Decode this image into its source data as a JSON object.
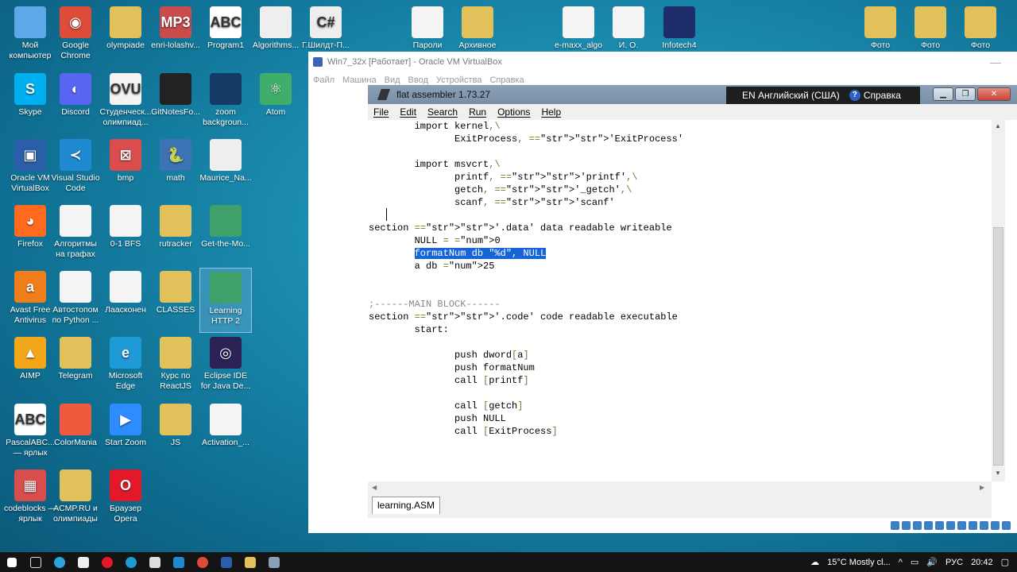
{
  "desktop_icons": [
    {
      "label": "Мой компьютер",
      "color": "#5fa8e8",
      "glyph": ""
    },
    {
      "label": "Google Chrome",
      "color": "#dd4b39",
      "glyph": "◉"
    },
    {
      "label": "olympiade",
      "color": "#e2c15a",
      "glyph": ""
    },
    {
      "label": "enri-lolashv...",
      "color": "#c94b4b",
      "glyph": "MP3"
    },
    {
      "label": "Program1",
      "color": "#ffffff",
      "glyph": "ABC"
    },
    {
      "label": "Algorithms...",
      "color": "#eeeeee",
      "glyph": ""
    },
    {
      "label": "Г.Шилдт-П...",
      "color": "#eeeeee",
      "glyph": "C#"
    },
    {
      "label": "Пароли",
      "color": "#f4f4f4",
      "glyph": ""
    },
    {
      "label": "Архивное",
      "color": "#e2c15a",
      "glyph": ""
    },
    {
      "label": "e-maxx_algo",
      "color": "#f4f4f4",
      "glyph": ""
    },
    {
      "label": "И. О.",
      "color": "#f4f4f4",
      "glyph": ""
    },
    {
      "label": "Infotech4",
      "color": "#1d2e6b",
      "glyph": ""
    },
    {
      "label": "Фото",
      "color": "#e2c15a",
      "glyph": ""
    },
    {
      "label": "Фото",
      "color": "#e2c15a",
      "glyph": ""
    },
    {
      "label": "Фото",
      "color": "#e2c15a",
      "glyph": ""
    },
    {
      "label": "Skype",
      "color": "#00aff0",
      "glyph": "S"
    },
    {
      "label": "Discord",
      "color": "#5865f2",
      "glyph": "◐"
    },
    {
      "label": "Студенческ... олимпиад...",
      "color": "#f4f4f4",
      "glyph": "OVU"
    },
    {
      "label": "GitNotesFo...",
      "color": "#222222",
      "glyph": ""
    },
    {
      "label": "zoom backgroun...",
      "color": "#143a66",
      "glyph": ""
    },
    {
      "label": "Atom",
      "color": "#3fae6a",
      "glyph": "⚛"
    },
    {
      "label": "Oracle VM VirtualBox",
      "color": "#2a5ea8",
      "glyph": "▣"
    },
    {
      "label": "Visual Studio Code",
      "color": "#1f8ad2",
      "glyph": "≺"
    },
    {
      "label": "bmp",
      "color": "#d94d4d",
      "glyph": "⊠"
    },
    {
      "label": "math",
      "color": "#3b73b5",
      "glyph": "🐍"
    },
    {
      "label": "Maurice_Na...",
      "color": "#eeeeee",
      "glyph": ""
    },
    {
      "label": "Firefox",
      "color": "#ff6a1e",
      "glyph": "◕"
    },
    {
      "label": "Алгоритмы на графах",
      "color": "#f4f4f4",
      "glyph": ""
    },
    {
      "label": "0-1 BFS",
      "color": "#f4f4f4",
      "glyph": ""
    },
    {
      "label": "rutracker",
      "color": "#e2c15a",
      "glyph": ""
    },
    {
      "label": "Get-the-Mo...",
      "color": "#3fa06a",
      "glyph": ""
    },
    {
      "label": "Avast Free Antivirus",
      "color": "#f07e1a",
      "glyph": "a"
    },
    {
      "label": "Автостопом по Python ...",
      "color": "#f4f4f4",
      "glyph": ""
    },
    {
      "label": "Лаасконен",
      "color": "#f4f4f4",
      "glyph": ""
    },
    {
      "label": "CLASSES",
      "color": "#e2c15a",
      "glyph": ""
    },
    {
      "label": "Learning HTTP 2",
      "color": "#3fa06a",
      "glyph": ""
    },
    {
      "label": "AIMP",
      "color": "#f2a71b",
      "glyph": "▲"
    },
    {
      "label": "Telegram",
      "color": "#e2c15a",
      "glyph": ""
    },
    {
      "label": "Microsoft Edge",
      "color": "#1e9ad6",
      "glyph": "e"
    },
    {
      "label": "Курс по ReactJS",
      "color": "#e2c15a",
      "glyph": ""
    },
    {
      "label": "Eclipse IDE for Java De...",
      "color": "#2c2255",
      "glyph": "◎"
    },
    {
      "label": "PascalABC... — ярлык",
      "color": "#ffffff",
      "glyph": "ABC"
    },
    {
      "label": "ColorMania",
      "color": "#ef5a3c",
      "glyph": ""
    },
    {
      "label": "Start Zoom",
      "color": "#2d8cff",
      "glyph": "▶"
    },
    {
      "label": "JS",
      "color": "#e2c15a",
      "glyph": ""
    },
    {
      "label": "Activation_...",
      "color": "#f4f4f4",
      "glyph": ""
    },
    {
      "label": "codeblocks — ярлык",
      "color": "#d94d4d",
      "glyph": "▦"
    },
    {
      "label": "ACMP.RU и олимпиады",
      "color": "#e2c15a",
      "glyph": ""
    },
    {
      "label": "Браузер Opera",
      "color": "#e3192a",
      "glyph": "O"
    }
  ],
  "vm_window": {
    "title": "Win7_32x [Работает] - Oracle VM VirtualBox",
    "menu": [
      "Файл",
      "Машина",
      "Вид",
      "Ввод",
      "Устройства",
      "Справка"
    ]
  },
  "fasm": {
    "title": "flat assembler 1.73.27",
    "lang": "EN Английский (США)",
    "help": "Справка",
    "menu": [
      "File",
      "Edit",
      "Search",
      "Run",
      "Options",
      "Help"
    ],
    "tab": "learning.ASM",
    "code_lines": [
      "        import kernel,\\",
      "               ExitProcess, 'ExitProcess'",
      "",
      "        import msvcrt,\\",
      "               printf, 'printf',\\",
      "               getch, '_getch',\\",
      "               scanf, 'scanf'",
      "",
      "section '.data' data readable writeable",
      "        NULL = 0",
      "        formatNum db \"%d\", NULL",
      "        a db 25",
      "",
      "",
      ";------MAIN BLOCK------",
      "section '.code' code readable executable",
      "        start:",
      "",
      "               push dword[a]",
      "               push formatNum",
      "               call [printf]",
      "",
      "               call [getch]",
      "               push NULL",
      "               call [ExitProcess]"
    ],
    "selected_line": 10
  },
  "taskbar": {
    "weather": "15°C  Mostly cl...",
    "lang": "РУС",
    "time": "20:42"
  }
}
